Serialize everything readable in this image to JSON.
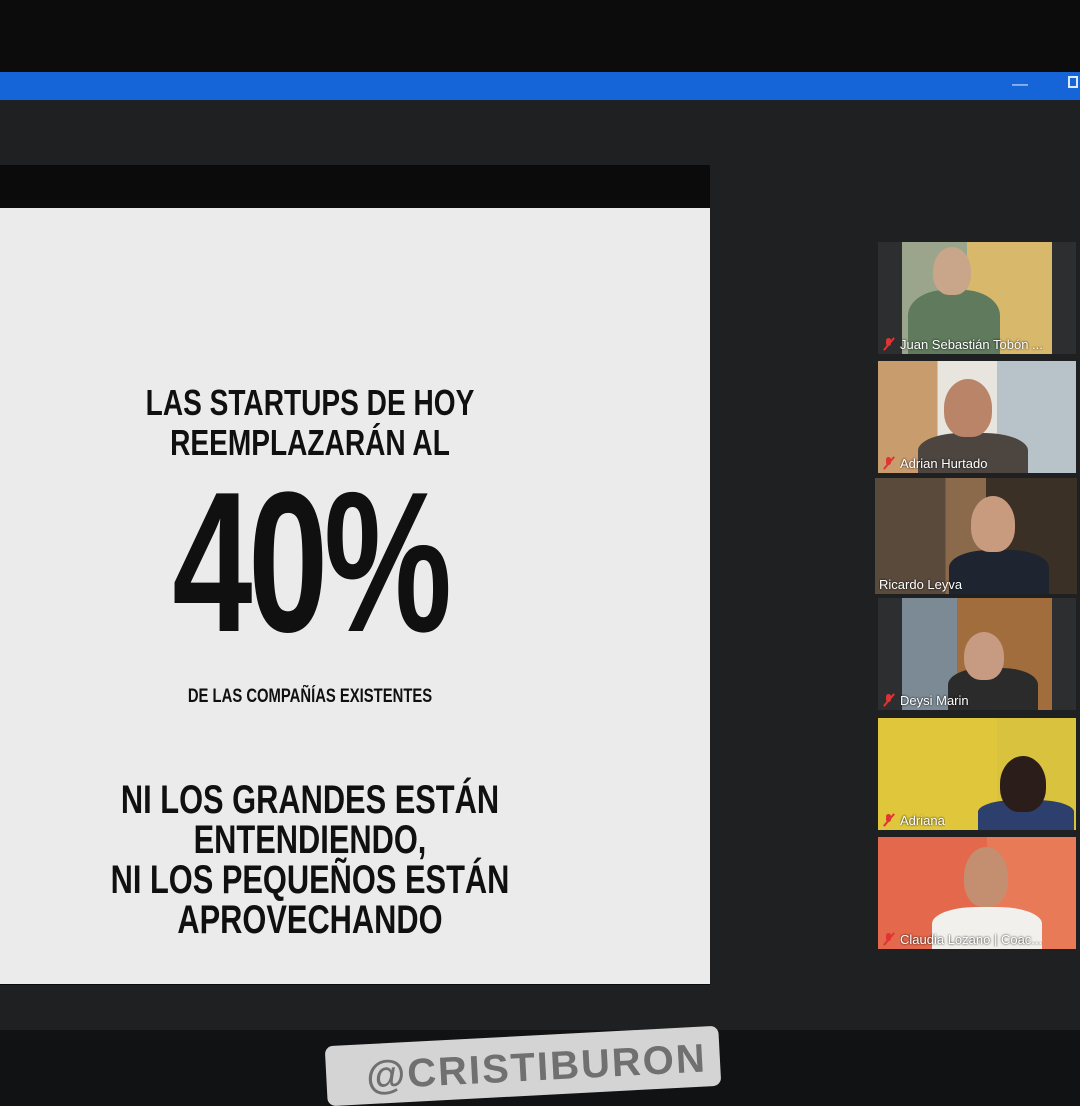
{
  "window": {
    "minimize_glyph": "—"
  },
  "slide": {
    "heading_line1": "LAS STARTUPS DE HOY",
    "heading_line2": "REEMPLAZARÁN AL",
    "big_number": "40%",
    "subheading": "DE LAS COMPAÑÍAS EXISTENTES",
    "footer_line1": "NI LOS GRANDES ESTÁN ENTENDIENDO,",
    "footer_line2": "NI LOS PEQUEÑOS ESTÁN APROVECHANDO"
  },
  "participants": [
    {
      "name": "Juan Sebastián Tobón ...",
      "muted": true,
      "active": false
    },
    {
      "name": "Adrian Hurtado",
      "muted": true,
      "active": false
    },
    {
      "name": "Ricardo Leyva",
      "muted": false,
      "active": true
    },
    {
      "name": "Deysi Marin",
      "muted": true,
      "active": false
    },
    {
      "name": "Adriana",
      "muted": true,
      "active": false
    },
    {
      "name": "Claudia Lozano | Coac...",
      "muted": true,
      "active": false
    }
  ],
  "sticker": {
    "text": "@CRISTIBURON"
  },
  "colors": {
    "title_bar": "#1565d8",
    "active_speaker_border": "#c9e34a",
    "muted_icon": "#e03434"
  }
}
